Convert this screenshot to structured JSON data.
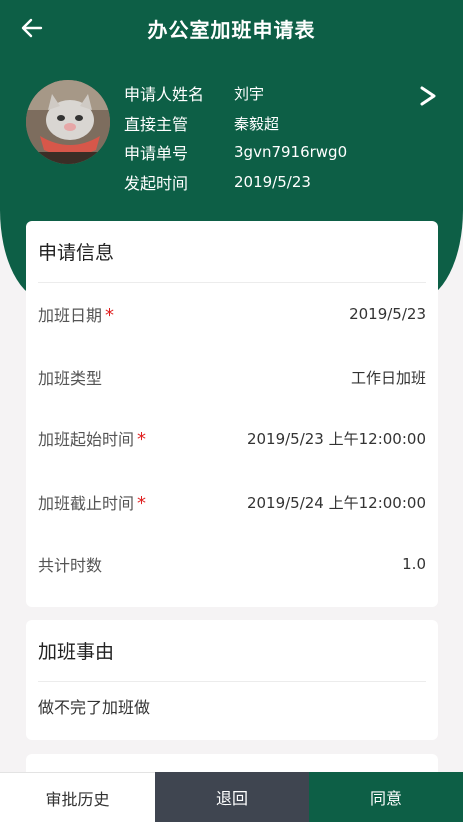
{
  "header": {
    "title": "办公室加班申请表"
  },
  "applicant": {
    "rows": [
      {
        "label": "申请人姓名",
        "value": "刘宇"
      },
      {
        "label": "直接主管",
        "value": "秦毅超"
      },
      {
        "label": "申请单号",
        "value": "3gvn7916rwg0"
      },
      {
        "label": "发起时间",
        "value": "2019/5/23"
      }
    ]
  },
  "application_info": {
    "title": "申请信息",
    "fields": [
      {
        "label": "加班日期",
        "required": true,
        "value": "2019/5/23"
      },
      {
        "label": "加班类型",
        "required": false,
        "value": "工作日加班"
      },
      {
        "label": "加班起始时间",
        "required": true,
        "value": "2019/5/23 上午12:00:00"
      },
      {
        "label": "加班截止时间",
        "required": true,
        "value": "2019/5/24 上午12:00:00"
      },
      {
        "label": "共计时数",
        "required": false,
        "value": "1.0"
      }
    ]
  },
  "reason": {
    "title": "加班事由",
    "text": "做不完了加班做"
  },
  "actions": {
    "history": "审批历史",
    "return": "退回",
    "agree": "同意"
  },
  "colors": {
    "primary": "#0d5f46",
    "dark": "#3f4550",
    "required": "#e02020"
  }
}
